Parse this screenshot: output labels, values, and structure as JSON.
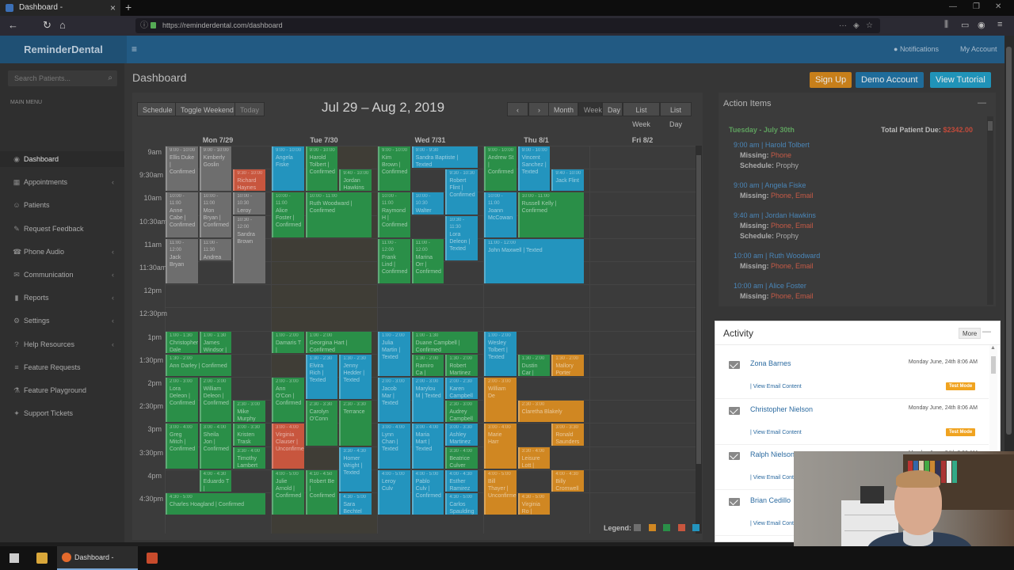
{
  "browser": {
    "tab_title": "Dashboard - ReminderDental",
    "url": "https://reminderdental.com/dashboard",
    "taskbar_app_label": "Dashboard - Remin..."
  },
  "app": {
    "brand": "ReminderDental",
    "notifications_label": "Notifications",
    "account_label": "My Account"
  },
  "sidebar": {
    "search_placeholder": "Search Patients...",
    "menu_header": "MAIN MENU",
    "items": [
      {
        "label": "Dashboard",
        "icon": "dashboard-icon",
        "active": true
      },
      {
        "label": "Appointments",
        "icon": "calendar-icon",
        "chevron": true
      },
      {
        "label": "Patients",
        "icon": "users-icon"
      },
      {
        "label": "Request Feedback",
        "icon": "feedback-icon"
      },
      {
        "label": "Phone Audio",
        "icon": "phone-icon",
        "chevron": true
      },
      {
        "label": "Communication",
        "icon": "chat-icon",
        "chevron": true
      },
      {
        "label": "Reports",
        "icon": "chart-icon",
        "chevron": true
      },
      {
        "label": "Settings",
        "icon": "gear-icon",
        "chevron": true
      },
      {
        "label": "Help Resources",
        "icon": "help-icon",
        "chevron": true
      },
      {
        "label": "Feature Requests",
        "icon": "list-icon"
      },
      {
        "label": "Feature Playground",
        "icon": "flask-icon"
      },
      {
        "label": "Support Tickets",
        "icon": "ticket-icon"
      }
    ]
  },
  "header": {
    "page_title": "Dashboard",
    "signup_label": "Sign Up",
    "demo_label": "Demo Account",
    "tutorial_label": "View Tutorial"
  },
  "calendar": {
    "toolbar_left": [
      "Schedule",
      "Toggle Weekend",
      "Today"
    ],
    "range_title": "Jul 29 – Aug 2, 2019",
    "prev_label": "‹",
    "next_label": "›",
    "views": [
      "Month",
      "Week",
      "Day",
      "List Week",
      "List Day"
    ],
    "active_view": "Week",
    "days": [
      "Mon 7/29",
      "Tue 7/30",
      "Wed 7/31",
      "Thu 8/1",
      "Fri 8/2"
    ],
    "times": [
      "9am",
      "9:30am",
      "10am",
      "10:30am",
      "11am",
      "11:30am",
      "12pm",
      "12:30pm",
      "1pm",
      "1:30pm",
      "2pm",
      "2:30pm",
      "3pm",
      "3:30pm",
      "4pm",
      "4:30pm"
    ],
    "legend_label": "Legend:",
    "legend_colors": [
      "#6e6e6e",
      "#d08722",
      "#2a8f48",
      "#c8563e",
      "#2394be"
    ],
    "appointments": [
      {
        "day": 0,
        "start": 0,
        "dur": 2,
        "col": 0,
        "w": 1,
        "c": "gr",
        "t": "9:00 - 10:00",
        "n": "Ellis Duke | Confirmed"
      },
      {
        "day": 0,
        "start": 0,
        "dur": 2,
        "col": 1,
        "w": 1,
        "c": "gr",
        "t": "9:00 - 10:00",
        "n": "Kimberly Goslin"
      },
      {
        "day": 0,
        "start": 1,
        "dur": 1,
        "col": 2,
        "w": 1,
        "c": "r",
        "t": "9:30 - 10:00",
        "n": "Richard Haynes"
      },
      {
        "day": 0,
        "start": 2,
        "dur": 2,
        "col": 0,
        "w": 1,
        "c": "gr",
        "t": "10:00 - 11:00",
        "n": "Anne Cabe | Confirmed"
      },
      {
        "day": 0,
        "start": 2,
        "dur": 2,
        "col": 1,
        "w": 1,
        "c": "gr",
        "t": "10:00 - 11:00",
        "n": "Mon Bryan | Confirmed"
      },
      {
        "day": 0,
        "start": 2,
        "dur": 1,
        "col": 2,
        "w": 1,
        "c": "gr",
        "t": "10:00 - 10:30",
        "n": "Leroy Swinson"
      },
      {
        "day": 0,
        "start": 3,
        "dur": 3,
        "col": 2,
        "w": 1,
        "c": "gr",
        "t": "10:30 - 12:00",
        "n": "Sandra Brown"
      },
      {
        "day": 0,
        "start": 4,
        "dur": 2,
        "col": 0,
        "w": 1,
        "c": "gr",
        "t": "11:00 - 12:00",
        "n": "Jack Bryan"
      },
      {
        "day": 0,
        "start": 4,
        "dur": 1,
        "col": 1,
        "w": 1,
        "c": "gr",
        "t": "11:00 - 11:30",
        "n": "Andrea Bu"
      },
      {
        "day": 1,
        "start": 0,
        "dur": 2,
        "col": 0,
        "w": 1,
        "c": "b",
        "t": "9:00 - 10:00",
        "n": "Angela Fiske"
      },
      {
        "day": 1,
        "start": 0,
        "dur": 2,
        "col": 1,
        "w": 1,
        "c": "g",
        "t": "9:00 - 10:00",
        "n": "Harold Tolbert | Confirmed"
      },
      {
        "day": 1,
        "start": 1,
        "dur": 1,
        "col": 2,
        "w": 1,
        "c": "g",
        "t": "9:40 - 10:00",
        "n": "Jordan Hawkins"
      },
      {
        "day": 1,
        "start": 2,
        "dur": 2,
        "col": 0,
        "w": 1,
        "c": "g",
        "t": "10:00 - 11:00",
        "n": "Alice Foster | Confirmed"
      },
      {
        "day": 1,
        "start": 2,
        "dur": 2,
        "col": 1,
        "w": 2,
        "c": "g",
        "t": "10:00 - 11:00",
        "n": "Ruth Woodward | Confirmed"
      },
      {
        "day": 2,
        "start": 0,
        "dur": 2,
        "col": 0,
        "w": 1,
        "c": "g",
        "t": "9:00 - 10:00",
        "n": "Kim Brown | Confirmed"
      },
      {
        "day": 2,
        "start": 0,
        "dur": 1,
        "col": 1,
        "w": 2,
        "c": "b",
        "t": "9:00 - 9:30",
        "n": "Sandra Baptiste | Texted"
      },
      {
        "day": 2,
        "start": 1,
        "dur": 2,
        "col": 2,
        "w": 1,
        "c": "b",
        "t": "9:30 - 10:30",
        "n": "Robert Flint | Confirmed"
      },
      {
        "day": 2,
        "start": 2,
        "dur": 2,
        "col": 0,
        "w": 1,
        "c": "g",
        "t": "10:00 - 11:00",
        "n": "Raymond H | Confirmed"
      },
      {
        "day": 2,
        "start": 2,
        "dur": 1,
        "col": 1,
        "w": 1,
        "c": "b",
        "t": "10:00 - 10:30",
        "n": "Walter Fisk"
      },
      {
        "day": 2,
        "start": 3,
        "dur": 2,
        "col": 2,
        "w": 1,
        "c": "b",
        "t": "10:30 - 11:30",
        "n": "Lora Deleon | Texted"
      },
      {
        "day": 2,
        "start": 4,
        "dur": 2,
        "col": 0,
        "w": 1,
        "c": "g",
        "t": "11:00 - 12:00",
        "n": "Frank Lind | Confirmed"
      },
      {
        "day": 2,
        "start": 4,
        "dur": 2,
        "col": 1,
        "w": 1,
        "c": "g",
        "t": "11:00 - 12:00",
        "n": "Marina Orr | Confirmed"
      },
      {
        "day": 3,
        "start": 0,
        "dur": 2,
        "col": 0,
        "w": 1,
        "c": "g",
        "t": "9:00 - 10:00",
        "n": "Andrew St | Confirmed"
      },
      {
        "day": 3,
        "start": 0,
        "dur": 2,
        "col": 1,
        "w": 1,
        "c": "b",
        "t": "9:00 - 10:00",
        "n": "Vincent Sanchez | Texted"
      },
      {
        "day": 3,
        "start": 1,
        "dur": 1,
        "col": 2,
        "w": 1,
        "c": "b",
        "t": "9:40 - 10:00",
        "n": "Jack Flint"
      },
      {
        "day": 3,
        "start": 2,
        "dur": 2,
        "col": 0,
        "w": 1,
        "c": "b",
        "t": "10:00 - 11:00",
        "n": "Joann McCowan"
      },
      {
        "day": 3,
        "start": 2,
        "dur": 2,
        "col": 1,
        "w": 2,
        "c": "g",
        "t": "10:00 - 11:00",
        "n": "Russell Kelly | Confirmed"
      },
      {
        "day": 3,
        "start": 4,
        "dur": 2,
        "col": 0,
        "w": 3,
        "c": "b",
        "t": "11:00 - 12:00",
        "n": "John Maxwell | Texted"
      },
      {
        "day": 0,
        "start": 8,
        "dur": 1,
        "col": 0,
        "w": 1,
        "c": "g",
        "t": "1:00 - 1:30",
        "n": "Christopher Dale"
      },
      {
        "day": 0,
        "start": 8,
        "dur": 1,
        "col": 1,
        "w": 1,
        "c": "g",
        "t": "1:00 - 1:30",
        "n": "James Windsor | Confirmed"
      },
      {
        "day": 0,
        "start": 9,
        "dur": 1,
        "col": 0,
        "w": 2,
        "c": "g",
        "t": "1:30 - 2:00",
        "n": "Ann Darley | Confirmed"
      },
      {
        "day": 0,
        "start": 10,
        "dur": 2,
        "col": 0,
        "w": 1,
        "c": "g",
        "t": "2:00 - 3:00",
        "n": "Lora Deleon | Confirmed"
      },
      {
        "day": 0,
        "start": 10,
        "dur": 2,
        "col": 1,
        "w": 1,
        "c": "g",
        "t": "2:00 - 3:00",
        "n": "William Deleon | Confirmed"
      },
      {
        "day": 0,
        "start": 11,
        "dur": 1,
        "col": 2,
        "w": 1,
        "c": "g",
        "t": "2:30 - 3:00",
        "n": "Mike Murphy"
      },
      {
        "day": 0,
        "start": 12,
        "dur": 2,
        "col": 0,
        "w": 1,
        "c": "g",
        "t": "3:00 - 4:00",
        "n": "Greg Mitch | Confirmed"
      },
      {
        "day": 0,
        "start": 12,
        "dur": 2,
        "col": 1,
        "w": 1,
        "c": "g",
        "t": "3:00 - 4:00",
        "n": "Sheila Jon | Confirmed"
      },
      {
        "day": 0,
        "start": 12,
        "dur": 1,
        "col": 2,
        "w": 1,
        "c": "g",
        "t": "3:00 - 3:30",
        "n": "Kristen Trask"
      },
      {
        "day": 0,
        "start": 13,
        "dur": 1,
        "col": 2,
        "w": 1,
        "c": "g",
        "t": "3:30 - 4:00",
        "n": "Timothy Lambert"
      },
      {
        "day": 0,
        "start": 14,
        "dur": 1,
        "col": 1,
        "w": 1,
        "c": "g",
        "t": "4:00 - 4:30",
        "n": "Eduardo T | Confirmed"
      },
      {
        "day": 0,
        "start": 15,
        "dur": 1,
        "col": 0,
        "w": 3,
        "c": "g",
        "t": "4:30 - 5:00",
        "n": "Charles Hoagland | Confirmed"
      },
      {
        "day": 1,
        "start": 8,
        "dur": 1,
        "col": 0,
        "w": 1,
        "c": "g",
        "t": "1:00 - 2:00",
        "n": "Damaris T | Confirmed"
      },
      {
        "day": 1,
        "start": 8,
        "dur": 1,
        "col": 1,
        "w": 2,
        "c": "g",
        "t": "1:00 - 2:00",
        "n": "Georgina Hart | Confirmed"
      },
      {
        "day": 1,
        "start": 9,
        "dur": 2,
        "col": 1,
        "w": 1,
        "c": "b",
        "t": "1:30 - 2:30",
        "n": "Elvira Rich | Texted"
      },
      {
        "day": 1,
        "start": 9,
        "dur": 2,
        "col": 2,
        "w": 1,
        "c": "b",
        "t": "1:30 - 2:30",
        "n": "Jenny Hedder | Texted"
      },
      {
        "day": 1,
        "start": 10,
        "dur": 2,
        "col": 0,
        "w": 1,
        "c": "g",
        "t": "2:00 - 3:00",
        "n": "Ann O'Con | Confirmed"
      },
      {
        "day": 1,
        "start": 11,
        "dur": 2,
        "col": 1,
        "w": 1,
        "c": "g",
        "t": "2:30 - 3:30",
        "n": "Carolyn O'Conn"
      },
      {
        "day": 1,
        "start": 11,
        "dur": 2,
        "col": 2,
        "w": 1,
        "c": "g",
        "t": "2:30 - 3:30",
        "n": "Terrance"
      },
      {
        "day": 1,
        "start": 12,
        "dur": 2,
        "col": 0,
        "w": 1,
        "c": "r",
        "t": "3:00 - 4:00",
        "n": "Virginia Clauser | Unconfirmed"
      },
      {
        "day": 1,
        "start": 13,
        "dur": 2,
        "col": 2,
        "w": 1,
        "c": "b",
        "t": "3:30 - 4:30",
        "n": "Homer Wright | Texted"
      },
      {
        "day": 1,
        "start": 14,
        "dur": 2,
        "col": 0,
        "w": 1,
        "c": "g",
        "t": "4:00 - 5:00",
        "n": "Julie Arnold | Confirmed"
      },
      {
        "day": 1,
        "start": 14,
        "dur": 2,
        "col": 1,
        "w": 1,
        "c": "g",
        "t": "4:10 - 4:50",
        "n": "Robert Be | Confirmed"
      },
      {
        "day": 1,
        "start": 15,
        "dur": 1,
        "col": 2,
        "w": 1,
        "c": "b",
        "t": "4:30 - 5:00",
        "n": "Sara Bechtel"
      },
      {
        "day": 2,
        "start": 8,
        "dur": 2,
        "col": 0,
        "w": 1,
        "c": "b",
        "t": "1:00 - 2:00",
        "n": "Julia Martin | Texted"
      },
      {
        "day": 2,
        "start": 8,
        "dur": 1,
        "col": 1,
        "w": 2,
        "c": "g",
        "t": "1:00 - 1:30",
        "n": "Duane Campbell | Confirmed"
      },
      {
        "day": 2,
        "start": 9,
        "dur": 1,
        "col": 1,
        "w": 1,
        "c": "g",
        "t": "1:30 - 2:00",
        "n": "Ramiro Ca | Confirmed"
      },
      {
        "day": 2,
        "start": 9,
        "dur": 1,
        "col": 2,
        "w": 1,
        "c": "g",
        "t": "1:30 - 2:00",
        "n": "Robert Martinez"
      },
      {
        "day": 2,
        "start": 10,
        "dur": 2,
        "col": 0,
        "w": 1,
        "c": "b",
        "t": "2:00 - 3:00",
        "n": "Jacob Mar | Texted"
      },
      {
        "day": 2,
        "start": 10,
        "dur": 2,
        "col": 1,
        "w": 1,
        "c": "b",
        "t": "2:00 - 3:00",
        "n": "Marylou M | Texted"
      },
      {
        "day": 2,
        "start": 10,
        "dur": 1,
        "col": 2,
        "w": 1,
        "c": "b",
        "t": "2:00 - 2:30",
        "n": "Karen Campbell"
      },
      {
        "day": 2,
        "start": 11,
        "dur": 1,
        "col": 2,
        "w": 1,
        "c": "g",
        "t": "2:30 - 3:00",
        "n": "Audrey Campbell"
      },
      {
        "day": 2,
        "start": 12,
        "dur": 2,
        "col": 0,
        "w": 1,
        "c": "b",
        "t": "3:00 - 4:00",
        "n": "Lynn Chan | Texted"
      },
      {
        "day": 2,
        "start": 12,
        "dur": 2,
        "col": 1,
        "w": 1,
        "c": "b",
        "t": "3:00 - 4:00",
        "n": "Maria Mart | Texted"
      },
      {
        "day": 2,
        "start": 12,
        "dur": 1,
        "col": 2,
        "w": 1,
        "c": "b",
        "t": "3:00 - 3:30",
        "n": "Ashley Martinez"
      },
      {
        "day": 2,
        "start": 13,
        "dur": 1,
        "col": 2,
        "w": 1,
        "c": "g",
        "t": "3:30 - 4:00",
        "n": "Beatrice Culver"
      },
      {
        "day": 2,
        "start": 14,
        "dur": 2,
        "col": 0,
        "w": 1,
        "c": "b",
        "t": "4:00 - 5:00",
        "n": "Leroy Culv"
      },
      {
        "day": 2,
        "start": 14,
        "dur": 2,
        "col": 1,
        "w": 1,
        "c": "b",
        "t": "4:00 - 5:00",
        "n": "Pablo Culv | Confirmed"
      },
      {
        "day": 2,
        "start": 14,
        "dur": 1,
        "col": 2,
        "w": 1,
        "c": "b",
        "t": "4:00 - 4:30",
        "n": "Esther Ramirez"
      },
      {
        "day": 2,
        "start": 15,
        "dur": 1,
        "col": 2,
        "w": 1,
        "c": "b",
        "t": "4:30 - 5:00",
        "n": "Carlos Spaulding"
      },
      {
        "day": 3,
        "start": 8,
        "dur": 2,
        "col": 0,
        "w": 1,
        "c": "b",
        "t": "1:00 - 2:00",
        "n": "Wesley Tolbert | Texted"
      },
      {
        "day": 3,
        "start": 9,
        "dur": 1,
        "col": 1,
        "w": 1,
        "c": "g",
        "t": "1:30 - 2:00",
        "n": "Dustin Car | Confirmed"
      },
      {
        "day": 3,
        "start": 9,
        "dur": 1,
        "col": 2,
        "w": 1,
        "c": "o",
        "t": "1:30 - 2:00",
        "n": "Mallory Porter"
      },
      {
        "day": 3,
        "start": 10,
        "dur": 2,
        "col": 0,
        "w": 1,
        "c": "o",
        "t": "2:00 - 3:00",
        "n": "William De"
      },
      {
        "day": 3,
        "start": 11,
        "dur": 1,
        "col": 1,
        "w": 2,
        "c": "o",
        "t": "2:30 - 3:00",
        "n": "Claretha Blakely"
      },
      {
        "day": 3,
        "start": 12,
        "dur": 2,
        "col": 0,
        "w": 1,
        "c": "o",
        "t": "3:00 - 4:00",
        "n": "Marie Harr"
      },
      {
        "day": 3,
        "start": 12,
        "dur": 1,
        "col": 2,
        "w": 1,
        "c": "o",
        "t": "3:00 - 3:30",
        "n": "Ronald Saunders"
      },
      {
        "day": 3,
        "start": 13,
        "dur": 1,
        "col": 1,
        "w": 1,
        "c": "o",
        "t": "3:30 - 4:00",
        "n": "Leisure Lott | Unconfirmed"
      },
      {
        "day": 3,
        "start": 14,
        "dur": 2,
        "col": 0,
        "w": 1,
        "c": "o",
        "t": "4:00 - 5:00",
        "n": "Bill Thayer | Unconfirmed"
      },
      {
        "day": 3,
        "start": 14,
        "dur": 1,
        "col": 2,
        "w": 1,
        "c": "o",
        "t": "4:00 - 4:30",
        "n": "Billy Cromwell"
      },
      {
        "day": 3,
        "start": 15,
        "dur": 1,
        "col": 1,
        "w": 1,
        "c": "o",
        "t": "4:30 - 5:00",
        "n": "Virginia Ro | Confirmed"
      }
    ]
  },
  "actions": {
    "title": "Action Items",
    "date_label": "Tuesday - July 30th",
    "total_label": "Total Patient Due:",
    "total_value": "$2342.00",
    "entries": [
      {
        "h": "9:00 am | Harold Tolbert",
        "missing": "Phone",
        "schedule": "Prophy"
      },
      {
        "h": "9:00 am | Angela Fiske",
        "missing": "Phone, Email"
      },
      {
        "h": "9:40 am | Jordan Hawkins",
        "missing": "Phone, Email",
        "schedule": "Prophy"
      },
      {
        "h": "10:00 am | Ruth Woodward",
        "missing": "Phone, Email"
      },
      {
        "h": "10:00 am | Alice Foster",
        "missing": "Phone, Email"
      }
    ],
    "missing_label": "Missing:",
    "schedule_label": "Schedule:"
  },
  "activity": {
    "title": "Activity",
    "more_label": "More",
    "items": [
      {
        "name": "Zona Barnes",
        "time": "Monday June, 24th 8:06 AM",
        "link": "| View Email Content",
        "badge": "Test Mode"
      },
      {
        "name": "Christopher Nielson",
        "time": "Monday June, 24th 8:06 AM",
        "link": "| View Email Content",
        "badge": "Test Mode"
      },
      {
        "name": "Ralph Nielson",
        "time": "Monday June, 24th 8:06 AM",
        "link": "| View Email Content"
      },
      {
        "name": "Brian Cedillo",
        "time": "",
        "link": "| View Email Content"
      }
    ]
  }
}
